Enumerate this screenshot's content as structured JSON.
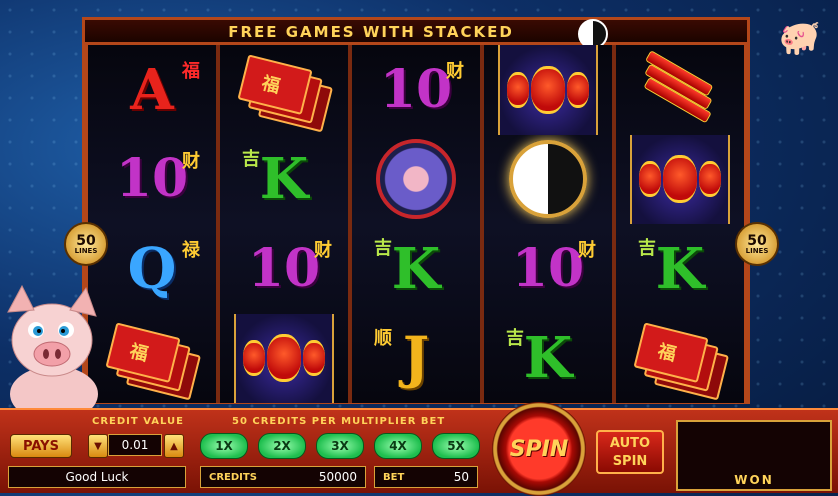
{
  "banner": {
    "title": "FREE GAMES WITH STACKED"
  },
  "lines_badge": {
    "count": "50",
    "label": "LINES"
  },
  "reels": [
    [
      {
        "type": "A",
        "cn": "福"
      },
      {
        "type": "10",
        "cn": "财"
      },
      {
        "type": "Q",
        "cn": "禄"
      },
      {
        "type": "book",
        "cn": "福"
      }
    ],
    [
      {
        "type": "book",
        "cn": "福"
      },
      {
        "type": "K",
        "cn": "吉"
      },
      {
        "type": "10",
        "cn": "财"
      },
      {
        "type": "lantern"
      }
    ],
    [
      {
        "type": "10",
        "cn": "财"
      },
      {
        "type": "wheel"
      },
      {
        "type": "K",
        "cn": "吉"
      },
      {
        "type": "J",
        "cn": "顺"
      }
    ],
    [
      {
        "type": "lantern"
      },
      {
        "type": "yinyang"
      },
      {
        "type": "10",
        "cn": "财"
      },
      {
        "type": "K",
        "cn": "吉"
      }
    ],
    [
      {
        "type": "firecracker"
      },
      {
        "type": "lantern"
      },
      {
        "type": "K",
        "cn": "吉"
      },
      {
        "type": "book",
        "cn": "福"
      }
    ]
  ],
  "controls": {
    "pays_label": "PAYS",
    "credit_value_label": "CREDIT VALUE",
    "credit_value": "0.01",
    "message": "Good Luck",
    "credits_per_bet_label": "50 CREDITS PER MULTIPLIER BET",
    "multipliers": [
      "1X",
      "2X",
      "3X",
      "4X",
      "5X"
    ],
    "credits_label": "CREDITS",
    "credits_value": "50000",
    "bet_label": "BET",
    "bet_value": "50",
    "spin_label": "SPIN",
    "auto_spin_line1": "AUTO",
    "auto_spin_line2": "SPIN",
    "won_label": "WON",
    "won_value": ""
  }
}
